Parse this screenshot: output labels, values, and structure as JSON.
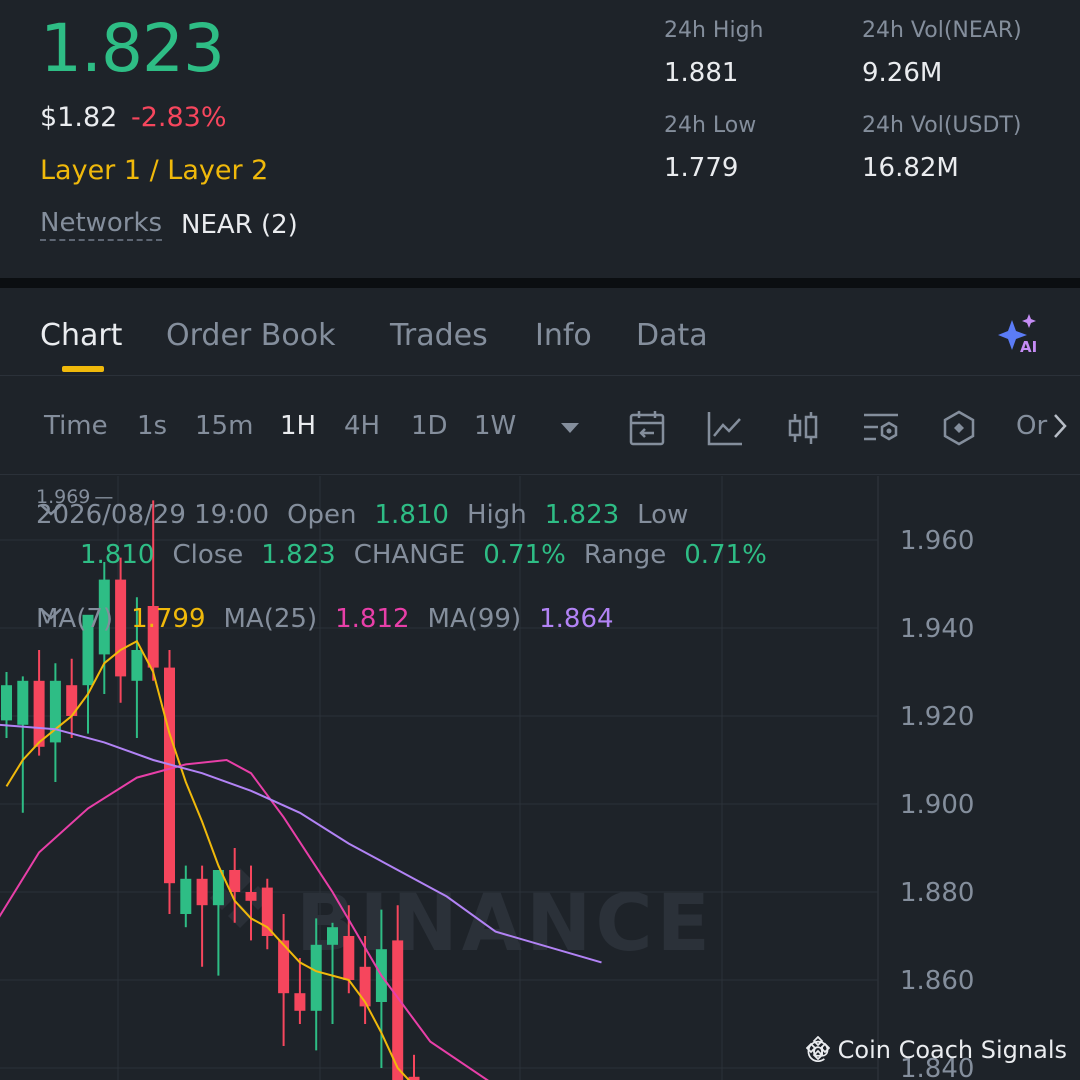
{
  "header": {
    "price": "1.823",
    "usd": "$1.82",
    "change": "-2.83%",
    "tag": "Layer 1 / Layer 2",
    "networks_label": "Networks",
    "networks_value": "NEAR (2)",
    "high_label": "24h High",
    "high_value": "1.881",
    "low_label": "24h Low",
    "low_value": "1.779",
    "vol_near_label": "24h Vol(NEAR)",
    "vol_near_value": "9.26M",
    "vol_usdt_label": "24h Vol(USDT)",
    "vol_usdt_value": "16.82M"
  },
  "tabs": [
    {
      "label": "Chart",
      "active": true
    },
    {
      "label": "Order Book"
    },
    {
      "label": "Trades"
    },
    {
      "label": "Info"
    },
    {
      "label": "Data"
    }
  ],
  "toolbar": {
    "timeframes": [
      {
        "label": "Time"
      },
      {
        "label": "1s"
      },
      {
        "label": "15m"
      },
      {
        "label": "1H",
        "active": true
      },
      {
        "label": "4H"
      },
      {
        "label": "1D"
      },
      {
        "label": "1W"
      }
    ],
    "more_label": "Or",
    "icons": [
      "calendar-icon",
      "line-chart-icon",
      "candle-icon",
      "indicator-settings-icon",
      "hexagon-icon"
    ]
  },
  "chart": {
    "max_label": "1.969",
    "date": "2026/08/29 19:00",
    "open_label": "Open",
    "open_value": "1.810",
    "high_label": "High",
    "high_value": "1.823",
    "low_label": "Low",
    "low_value": "1.810",
    "close_label": "Close",
    "close_value": "1.823",
    "change_label": "CHANGE",
    "change_value": "0.71%",
    "range_label": "Range",
    "range_value": "0.71%",
    "ma7_label": "MA(7)",
    "ma7_value": "1.799",
    "ma25_label": "MA(25)",
    "ma25_value": "1.812",
    "ma99_label": "MA(99)",
    "ma99_value": "1.864",
    "watermark_logo": "BINANCE",
    "credit": "@ Coin Coach Signals"
  },
  "chart_data": {
    "type": "candlestick",
    "y_ticks": [
      "1.960",
      "1.940",
      "1.920",
      "1.900",
      "1.880",
      "1.860",
      "1.840"
    ],
    "ylim": [
      1.836,
      1.969
    ],
    "candles": [
      {
        "o": 1.919,
        "h": 1.93,
        "l": 1.915,
        "c": 1.927
      },
      {
        "o": 1.918,
        "h": 1.929,
        "l": 1.898,
        "c": 1.928
      },
      {
        "o": 1.928,
        "h": 1.935,
        "l": 1.911,
        "c": 1.913
      },
      {
        "o": 1.914,
        "h": 1.932,
        "l": 1.905,
        "c": 1.928
      },
      {
        "o": 1.927,
        "h": 1.933,
        "l": 1.915,
        "c": 1.92
      },
      {
        "o": 1.927,
        "h": 1.94,
        "l": 1.916,
        "c": 1.943
      },
      {
        "o": 1.934,
        "h": 1.955,
        "l": 1.925,
        "c": 1.951
      },
      {
        "o": 1.951,
        "h": 1.956,
        "l": 1.923,
        "c": 1.929
      },
      {
        "o": 1.928,
        "h": 1.947,
        "l": 1.915,
        "c": 1.935
      },
      {
        "o": 1.945,
        "h": 1.969,
        "l": 1.928,
        "c": 1.931
      },
      {
        "o": 1.931,
        "h": 1.935,
        "l": 1.875,
        "c": 1.882
      },
      {
        "o": 1.875,
        "h": 1.886,
        "l": 1.872,
        "c": 1.883
      },
      {
        "o": 1.883,
        "h": 1.886,
        "l": 1.863,
        "c": 1.877
      },
      {
        "o": 1.877,
        "h": 1.881,
        "l": 1.861,
        "c": 1.885
      },
      {
        "o": 1.885,
        "h": 1.89,
        "l": 1.873,
        "c": 1.88
      },
      {
        "o": 1.88,
        "h": 1.886,
        "l": 1.869,
        "c": 1.878
      },
      {
        "o": 1.881,
        "h": 1.883,
        "l": 1.867,
        "c": 1.87
      },
      {
        "o": 1.869,
        "h": 1.875,
        "l": 1.845,
        "c": 1.857
      },
      {
        "o": 1.857,
        "h": 1.865,
        "l": 1.85,
        "c": 1.853
      },
      {
        "o": 1.853,
        "h": 1.874,
        "l": 1.844,
        "c": 1.868
      },
      {
        "o": 1.868,
        "h": 1.873,
        "l": 1.85,
        "c": 1.872
      },
      {
        "o": 1.87,
        "h": 1.877,
        "l": 1.857,
        "c": 1.86
      },
      {
        "o": 1.863,
        "h": 1.87,
        "l": 1.85,
        "c": 1.854
      },
      {
        "o": 1.855,
        "h": 1.876,
        "l": 1.84,
        "c": 1.867
      },
      {
        "o": 1.869,
        "h": 1.877,
        "l": 1.836,
        "c": 1.836
      },
      {
        "o": 1.838,
        "h": 1.843,
        "l": 1.836,
        "c": 1.836
      }
    ],
    "ma7": [
      1.904,
      1.91,
      1.914,
      1.917,
      1.92,
      1.925,
      1.932,
      1.935,
      1.937,
      1.93,
      1.916,
      1.905,
      1.896,
      1.886,
      1.878,
      1.874,
      1.872,
      1.868,
      1.864,
      1.862,
      1.861,
      1.86,
      1.855,
      1.848,
      1.84,
      1.836
    ],
    "ma25_points": [
      [
        -0.5,
        1.874
      ],
      [
        2,
        1.889
      ],
      [
        5,
        1.899
      ],
      [
        8,
        1.906
      ],
      [
        11,
        1.909
      ],
      [
        13.5,
        1.91
      ],
      [
        15,
        1.907
      ],
      [
        17,
        1.897
      ],
      [
        20,
        1.88
      ],
      [
        23,
        1.861
      ],
      [
        26,
        1.846
      ],
      [
        30,
        1.836
      ]
    ],
    "ma99_points": [
      [
        -0.5,
        1.918
      ],
      [
        3,
        1.917
      ],
      [
        6,
        1.914
      ],
      [
        9,
        1.91
      ],
      [
        12,
        1.907
      ],
      [
        15,
        1.903
      ],
      [
        18,
        1.898
      ],
      [
        21,
        1.891
      ],
      [
        24,
        1.885
      ],
      [
        27,
        1.879
      ],
      [
        30,
        1.871
      ],
      [
        36.5,
        1.864
      ]
    ]
  }
}
